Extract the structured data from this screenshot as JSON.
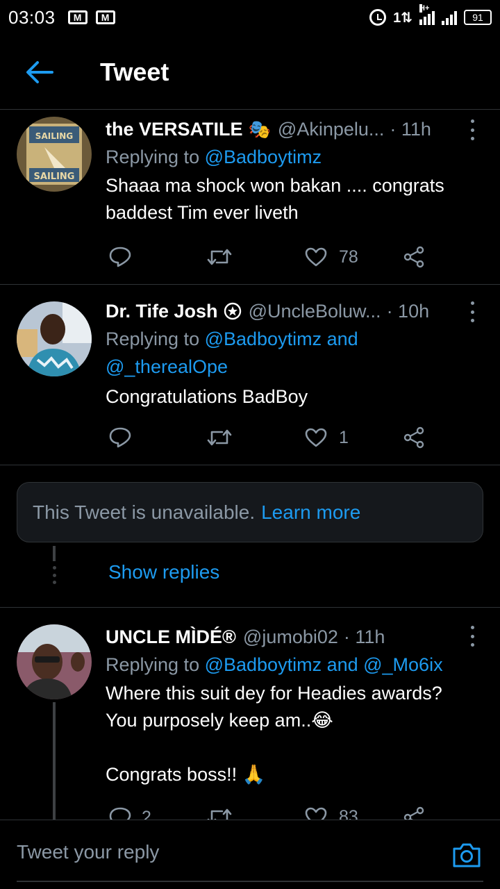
{
  "status_bar": {
    "time": "03:03",
    "battery": "91",
    "network_type": "H+"
  },
  "header": {
    "title": "Tweet"
  },
  "tweets": [
    {
      "name": "the VERSATILE",
      "emoji": "🎭",
      "handle": "@Akinpelu...",
      "time": "· 11h",
      "replying_prefix": "Replying to ",
      "replying_to": "@Badboytimz",
      "replying_to_line2": "",
      "text": "Shaaa ma shock won bakan .... congrats baddest Tim ever liveth",
      "reply_count": "",
      "retweet_count": "",
      "like_count": "78"
    },
    {
      "name": "Dr. Tife Josh",
      "emoji": "",
      "handle": "@UncleBoluw...",
      "time": "· 10h",
      "replying_prefix": "Replying to ",
      "replying_to": "@Badboytimz and",
      "replying_to_line2": "@_therealOpe",
      "text": "Congratulations BadBoy",
      "reply_count": "",
      "retweet_count": "",
      "like_count": "1"
    },
    {
      "name": "UNCLE MÌDÉ®",
      "emoji": "",
      "handle": "@jumobi02",
      "time": "· 11h",
      "replying_prefix": "Replying to ",
      "replying_to": "@Badboytimz and @_Mo6ix",
      "replying_to_line2": "",
      "text": "Where this suit dey for Headies awards?\nYou purposely keep am..😂\n\nCongrats boss!! 🙏",
      "reply_count": "2",
      "retweet_count": "",
      "like_count": "83"
    }
  ],
  "unavailable": {
    "message": "This Tweet is unavailable.",
    "link": "Learn more"
  },
  "show_replies": "Show replies",
  "composer": {
    "placeholder": "Tweet your reply"
  },
  "colors": {
    "background": "#000000",
    "accent": "#1d9bf0",
    "secondary_text": "#8b98a5",
    "divider": "#2f3336"
  }
}
